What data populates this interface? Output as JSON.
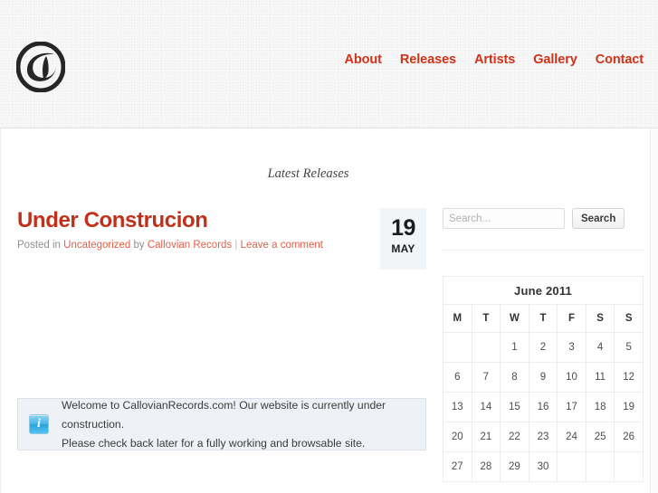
{
  "header": {
    "logo_alt": "Callovian Records logo",
    "nav": [
      {
        "label": "About"
      },
      {
        "label": "Releases"
      },
      {
        "label": "Artists"
      },
      {
        "label": "Gallery"
      },
      {
        "label": "Contact"
      }
    ]
  },
  "tagline": "Latest Releases",
  "post": {
    "title": "Under Construcion",
    "meta_prefix": "Posted in ",
    "category": "Uncategorized",
    "by_text": " by ",
    "author": "Callovian Records",
    "separator": " | ",
    "comment_link": "Leave a comment",
    "date_day": "19",
    "date_month": "MAY"
  },
  "info_box": {
    "icon": "info-icon",
    "line1": "Welcome to CallovianRecords.com! Our website is currently under construction.",
    "line2": "Please check back later for a fully working and browsable site."
  },
  "sidebar": {
    "search": {
      "placeholder": "Search...",
      "value": "",
      "button_label": "Search"
    },
    "calendar": {
      "prev_icon": "‹",
      "title": "June 2011",
      "weekdays": [
        "M",
        "T",
        "W",
        "T",
        "F",
        "S",
        "S"
      ],
      "weeks": [
        [
          "",
          "",
          "1",
          "2",
          "3",
          "4",
          "5"
        ],
        [
          "6",
          "7",
          "8",
          "9",
          "10",
          "11",
          "12"
        ],
        [
          "13",
          "14",
          "15",
          "16",
          "17",
          "18",
          "19"
        ],
        [
          "20",
          "21",
          "22",
          "23",
          "24",
          "25",
          "26"
        ],
        [
          "27",
          "28",
          "29",
          "30",
          "",
          "",
          ""
        ]
      ]
    }
  },
  "colors": {
    "accent_red": "#c0301a",
    "nav_red": "#d0321a",
    "meta_link": "#e2604a",
    "info_bg": "#eef2f6",
    "date_bg": "#f2f5f8"
  }
}
